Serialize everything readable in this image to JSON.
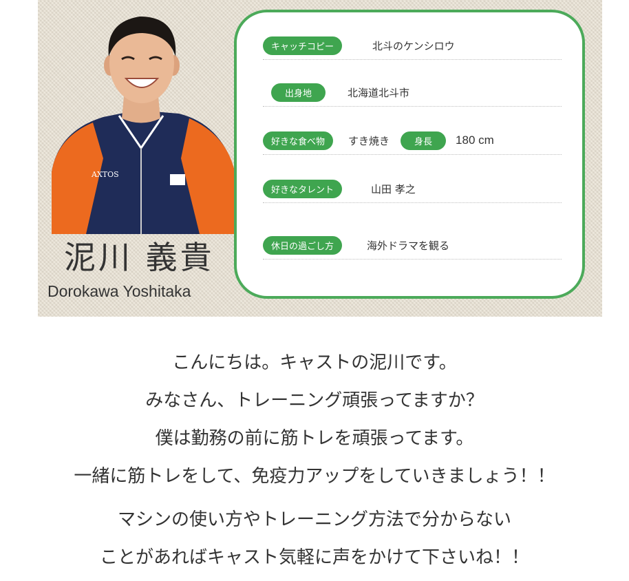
{
  "profile": {
    "name_jp": "泥川 義貴",
    "name_en": "Dorokawa Yoshitaka",
    "rows": [
      {
        "label": "キャッチコピー",
        "value": "北斗のケンシロウ"
      },
      {
        "label": "出身地",
        "value": "北海道北斗市"
      },
      {
        "label": "好きな食べ物",
        "value": "すき焼き",
        "label2": "身長",
        "value2": "180 cm"
      },
      {
        "label": "好きなタレント",
        "value": "山田 孝之"
      },
      {
        "label": "休日の過ごし方",
        "value": "海外ドラマを観る"
      }
    ],
    "shirt_logo": "AXTOS",
    "accent_color": "#4caa5a"
  },
  "message": {
    "lines": [
      "こんにちは。キャストの泥川です。",
      "みなさん、トレーニング頑張ってますか？",
      "僕は勤務の前に筋トレを頑張ってます。",
      "一緒に筋トレをして、免疫力アップをしていきましょう！！"
    ],
    "lines2": [
      "マシンの使い方やトレーニング方法で分からない",
      "ことがあればキャスト気軽に声をかけて下さいね！！"
    ]
  }
}
